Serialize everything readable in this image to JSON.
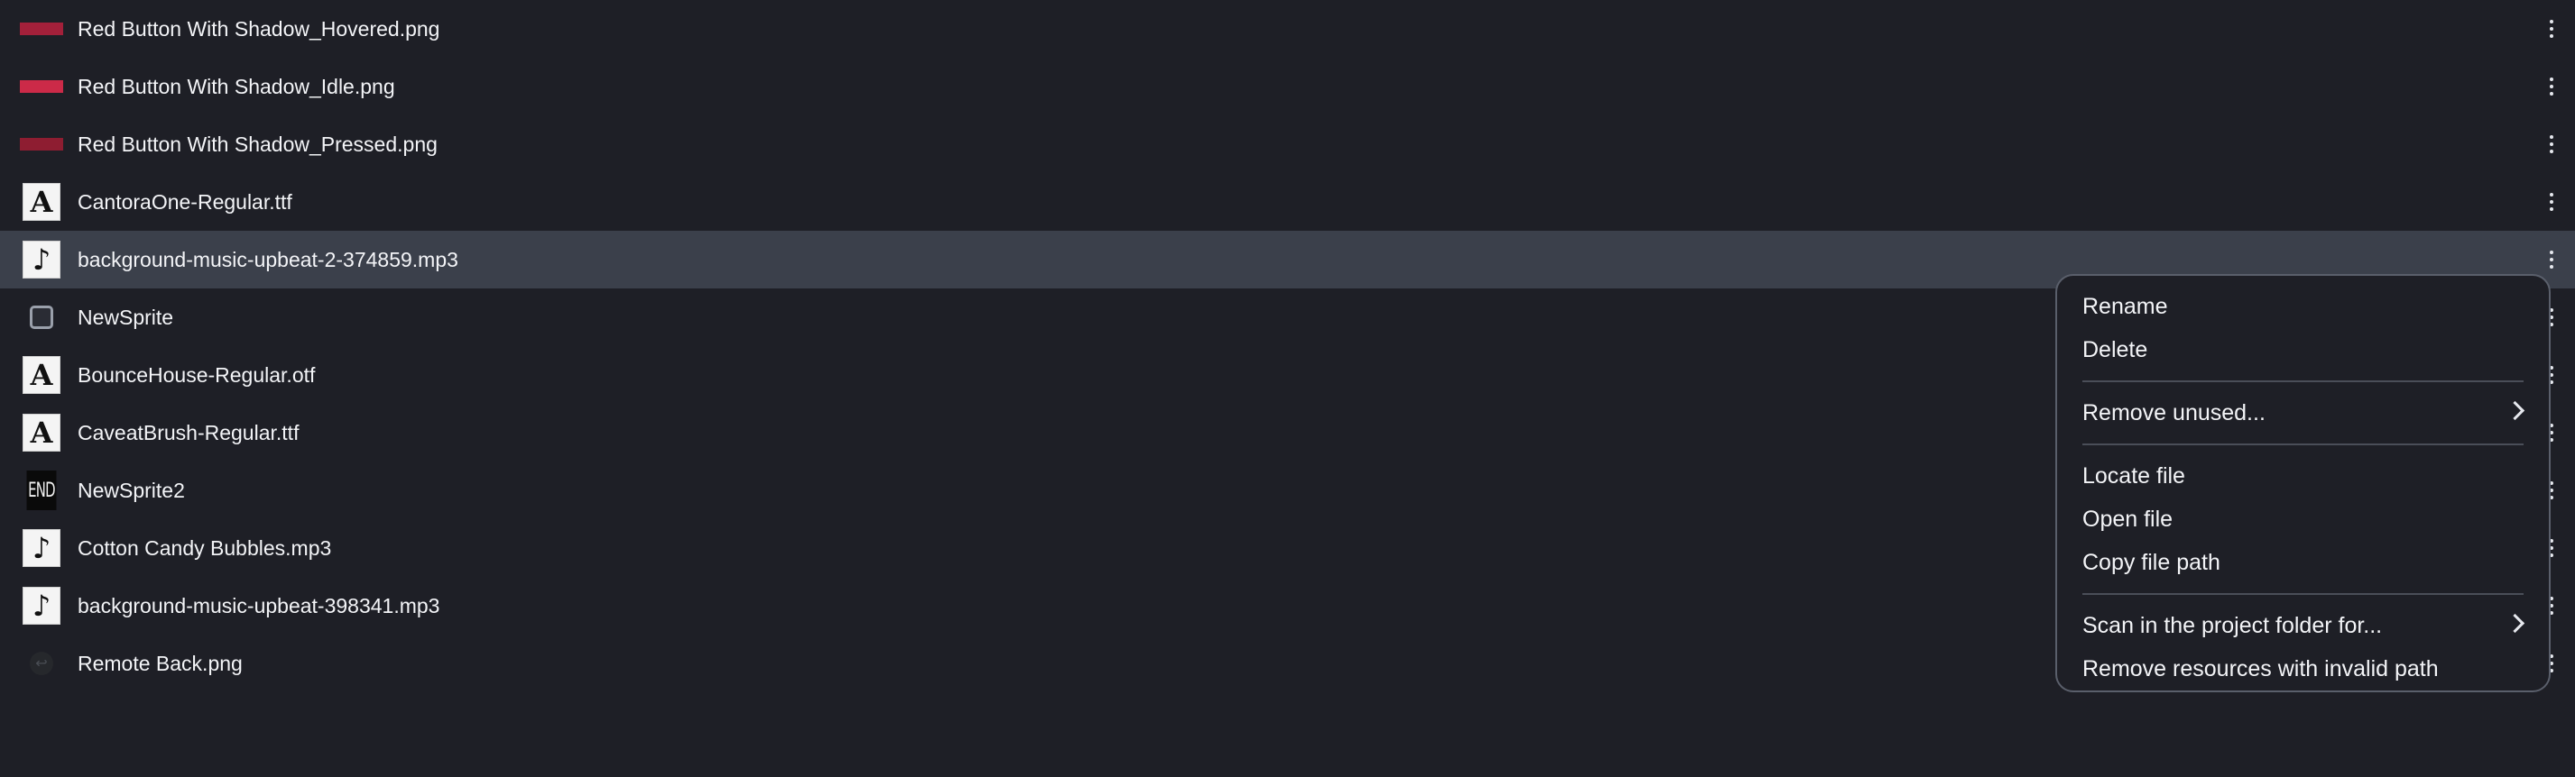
{
  "resources": [
    {
      "name": "Red Button With Shadow_Hovered.png",
      "thumb": "red-button",
      "color": "#a3203a",
      "selected": false
    },
    {
      "name": "Red Button With Shadow_Idle.png",
      "thumb": "red-button",
      "color": "#cc2a48",
      "selected": false
    },
    {
      "name": "Red Button With Shadow_Pressed.png",
      "thumb": "red-button",
      "color": "#8e1d31",
      "selected": false
    },
    {
      "name": "CantoraOne-Regular.ttf",
      "thumb": "font",
      "glyph": "A",
      "selected": false
    },
    {
      "name": "background-music-upbeat-2-374859.mp3",
      "thumb": "music",
      "glyph": "♪",
      "selected": true
    },
    {
      "name": "NewSprite",
      "thumb": "sprite",
      "selected": false
    },
    {
      "name": "BounceHouse-Regular.otf",
      "thumb": "font",
      "glyph": "A",
      "selected": false
    },
    {
      "name": "CaveatBrush-Regular.ttf",
      "thumb": "font",
      "glyph": "A",
      "selected": false
    },
    {
      "name": "NewSprite2",
      "thumb": "end",
      "glyph": "END",
      "selected": false
    },
    {
      "name": "Cotton Candy Bubbles.mp3",
      "thumb": "music",
      "glyph": "♪",
      "selected": false
    },
    {
      "name": "background-music-upbeat-398341.mp3",
      "thumb": "music",
      "glyph": "♪",
      "selected": false
    },
    {
      "name": "Remote Back.png",
      "thumb": "back",
      "glyph": "↩",
      "selected": false
    }
  ],
  "context_menu": {
    "groups": [
      [
        {
          "label": "Rename",
          "submenu": false
        },
        {
          "label": "Delete",
          "submenu": false
        }
      ],
      [
        {
          "label": "Remove unused...",
          "submenu": true
        }
      ],
      [
        {
          "label": "Locate file",
          "submenu": false
        },
        {
          "label": "Open file",
          "submenu": false
        },
        {
          "label": "Copy file path",
          "submenu": false
        }
      ],
      [
        {
          "label": "Scan in the project folder for...",
          "submenu": true
        },
        {
          "label": "Remove resources with invalid path",
          "submenu": false
        }
      ]
    ]
  },
  "colors": {
    "background": "#1e1f26",
    "selected_row": "#3b404b",
    "menu_border": "#5a5f6b"
  }
}
